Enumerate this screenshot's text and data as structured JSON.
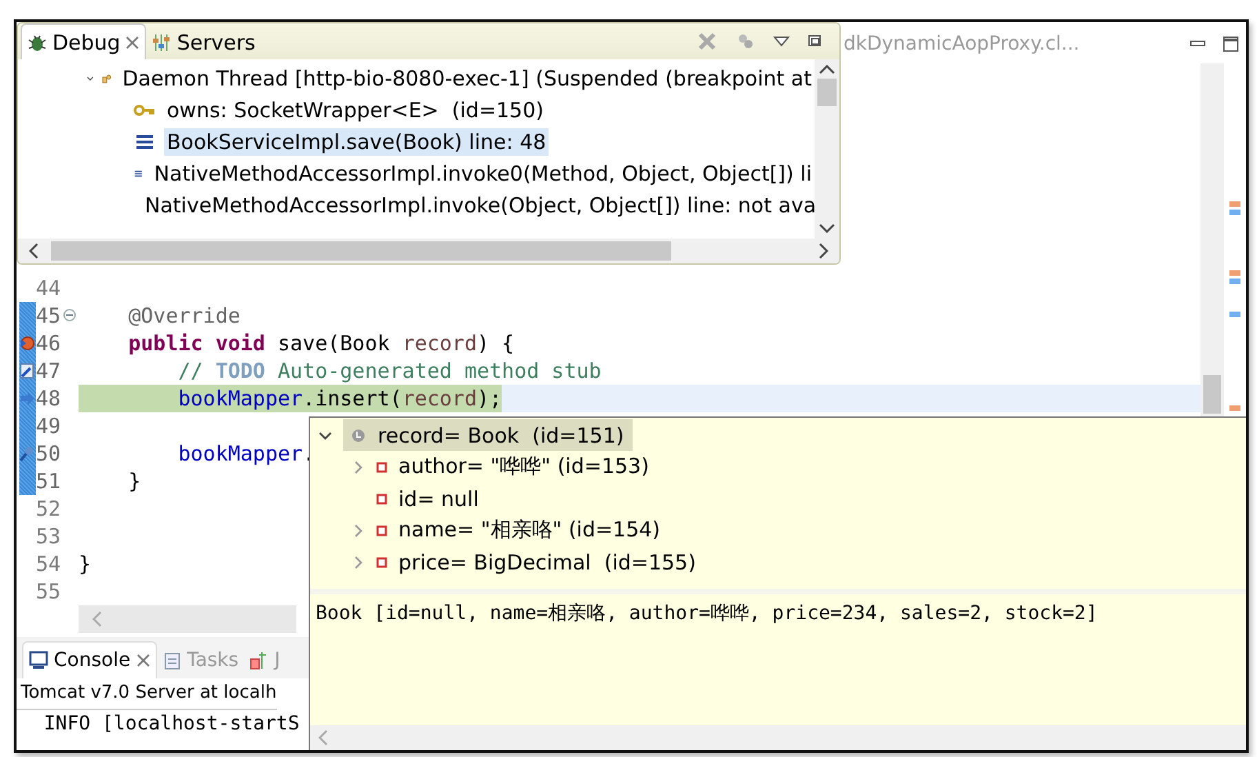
{
  "editor": {
    "tab_title": "dkDynamicAopProxy.cl...",
    "lines": [
      {
        "number": "44",
        "kind": "plain",
        "in_range": false,
        "current": false
      },
      {
        "number": "45",
        "kind": "fold",
        "in_range": true,
        "current": false,
        "tokens": [
          {
            "kind": "annotation",
            "text": "    @Override"
          }
        ]
      },
      {
        "number": "46",
        "kind": "breakpoint",
        "in_range": true,
        "current": false,
        "tokens": [
          {
            "kind": "keyword",
            "text": "    public"
          },
          {
            "kind": "keyword",
            "text": " void"
          },
          {
            "kind": "plain",
            "text": " save(Book "
          },
          {
            "kind": "param",
            "text": "record"
          },
          {
            "kind": "plain",
            "text": ") {"
          }
        ]
      },
      {
        "number": "47",
        "kind": "task",
        "in_range": true,
        "current": false,
        "tokens": [
          {
            "kind": "comment",
            "text": "        // "
          },
          {
            "kind": "todo",
            "text": "TODO"
          },
          {
            "kind": "comment",
            "text": " Auto-generated method stub"
          }
        ]
      },
      {
        "number": "48",
        "kind": "instruction-pointer",
        "in_range": true,
        "current": true,
        "tokens": [
          {
            "kind": "field",
            "text": "        bookMapper"
          },
          {
            "kind": "plain",
            "text": ".insert("
          },
          {
            "kind": "param",
            "text": "record"
          },
          {
            "kind": "plain",
            "text": ");"
          }
        ]
      },
      {
        "number": "49",
        "kind": "plain",
        "in_range": true,
        "current": false
      },
      {
        "number": "50",
        "kind": "breakpoint-search",
        "in_range": true,
        "current": false,
        "tokens": [
          {
            "kind": "field",
            "text": "        bookMapper"
          },
          {
            "kind": "plain",
            "text": "."
          }
        ]
      },
      {
        "number": "51",
        "kind": "plain",
        "in_range": true,
        "current": false,
        "tokens": [
          {
            "kind": "plain",
            "text": "    }"
          }
        ]
      },
      {
        "number": "52",
        "kind": "plain",
        "in_range": false,
        "current": false
      },
      {
        "number": "53",
        "kind": "plain",
        "in_range": false,
        "current": false
      },
      {
        "number": "54",
        "kind": "plain",
        "in_range": false,
        "current": false,
        "tokens": [
          {
            "kind": "plain",
            "text": "}"
          }
        ]
      },
      {
        "number": "55",
        "kind": "plain",
        "in_range": false,
        "current": false
      }
    ]
  },
  "debug_view": {
    "tabs": [
      {
        "label": "Debug",
        "selected": true,
        "closable": true
      },
      {
        "label": "Servers",
        "selected": false,
        "closable": false
      }
    ],
    "tree": [
      {
        "kind": "thread",
        "label": "Daemon Thread [http-bio-8080-exec-1] (Suspended (breakpoint at",
        "expanded": true,
        "selected": false,
        "children": [
          {
            "kind": "monitor",
            "label": "owns: SocketWrapper<E>  (id=150)",
            "selected": false
          },
          {
            "kind": "frame",
            "label": "BookServiceImpl.save(Book) line: 48",
            "selected": true
          },
          {
            "kind": "frame",
            "label": "NativeMethodAccessorImpl.invoke0(Method, Object, Object[]) li",
            "selected": false
          },
          {
            "kind": "frame",
            "label": "NativeMethodAccessorImpl.invoke(Object, Object[]) line: not ava",
            "selected": false
          }
        ]
      }
    ]
  },
  "console": {
    "tabs": [
      {
        "label": "Console",
        "selected": true,
        "closable": true
      },
      {
        "label": "Tasks",
        "selected": false,
        "closable": false
      },
      {
        "label": "J",
        "selected": false,
        "closable": false
      }
    ],
    "lines": [
      "Tomcat v7.0 Server at localh",
      "  INFO [localhost-startS"
    ]
  },
  "hover": {
    "tree": [
      {
        "label": "record= Book  (id=151)",
        "expanded": true,
        "selected": true,
        "children": [
          {
            "label": "author= \"哗哗\" (id=153)",
            "expandable": true
          },
          {
            "label": "id= null",
            "expandable": false
          },
          {
            "label": "name= \"相亲咯\" (id=154)",
            "expandable": true
          },
          {
            "label": "price= BigDecimal  (id=155)",
            "expandable": true
          }
        ]
      }
    ],
    "detail": "Book [id=null, name=相亲咯, author=哗哗, price=234, sales=2, stock=2]"
  }
}
